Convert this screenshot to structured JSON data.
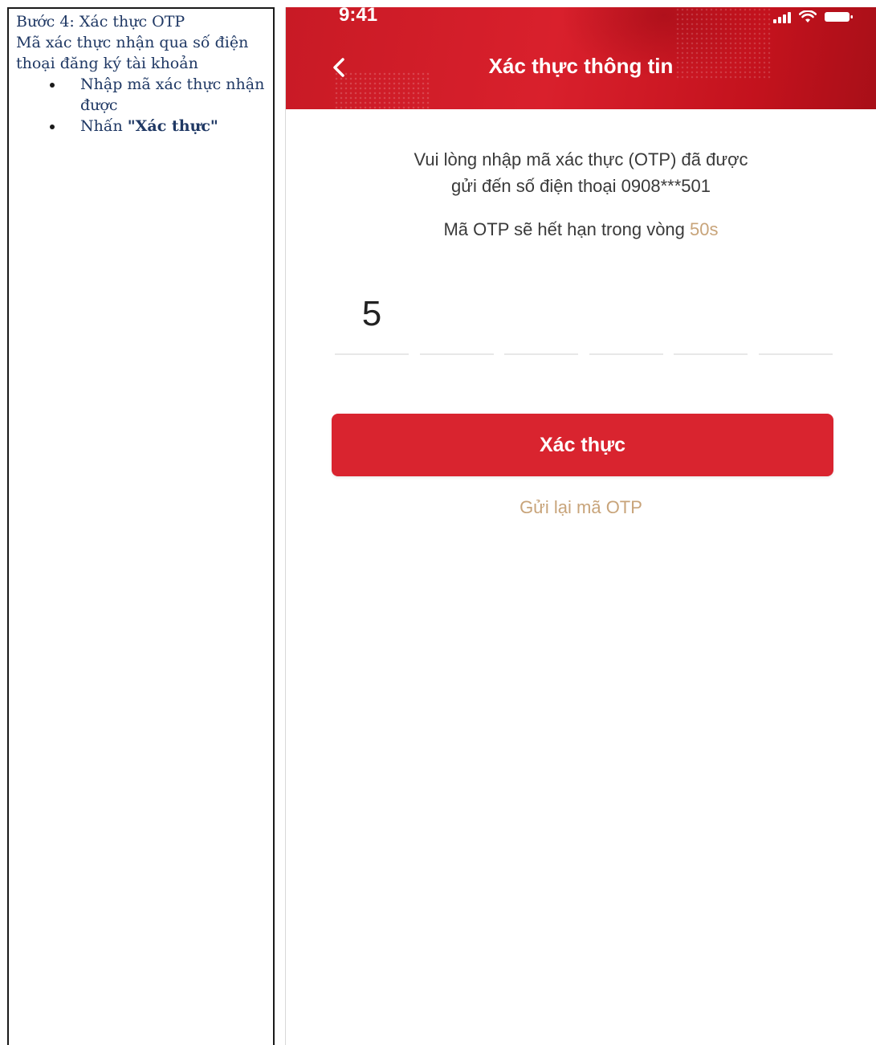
{
  "instructions": {
    "step_title": "Bước 4: Xác thực OTP",
    "description": "Mã xác thực nhận qua số điện thoại đăng ký tài khoản",
    "bullets": [
      {
        "text": "Nhập mã xác thực nhận được"
      },
      {
        "prefix": "Nhấn ",
        "bold": "\"Xác thực\""
      }
    ]
  },
  "status_bar": {
    "time": "9:41"
  },
  "header": {
    "title": "Xác thực thông tin",
    "back_icon": "chevron-left-icon"
  },
  "otp_screen": {
    "message_line1": "Vui lòng nhập mã xác thực (OTP) đã được",
    "message_line2": "gửi đến số điện thoại 0908***501",
    "expire_prefix": "Mã OTP sẽ hết hạn trong vòng ",
    "countdown": "50s",
    "otp_digits": [
      "5",
      "",
      "",
      "",
      "",
      ""
    ],
    "verify_label": "Xác thực",
    "resend_label": "Gửi lại mã OTP"
  },
  "colors": {
    "brand_red": "#d9242f",
    "accent_gold": "#c8a47a",
    "instruction_text": "#1f3864"
  }
}
